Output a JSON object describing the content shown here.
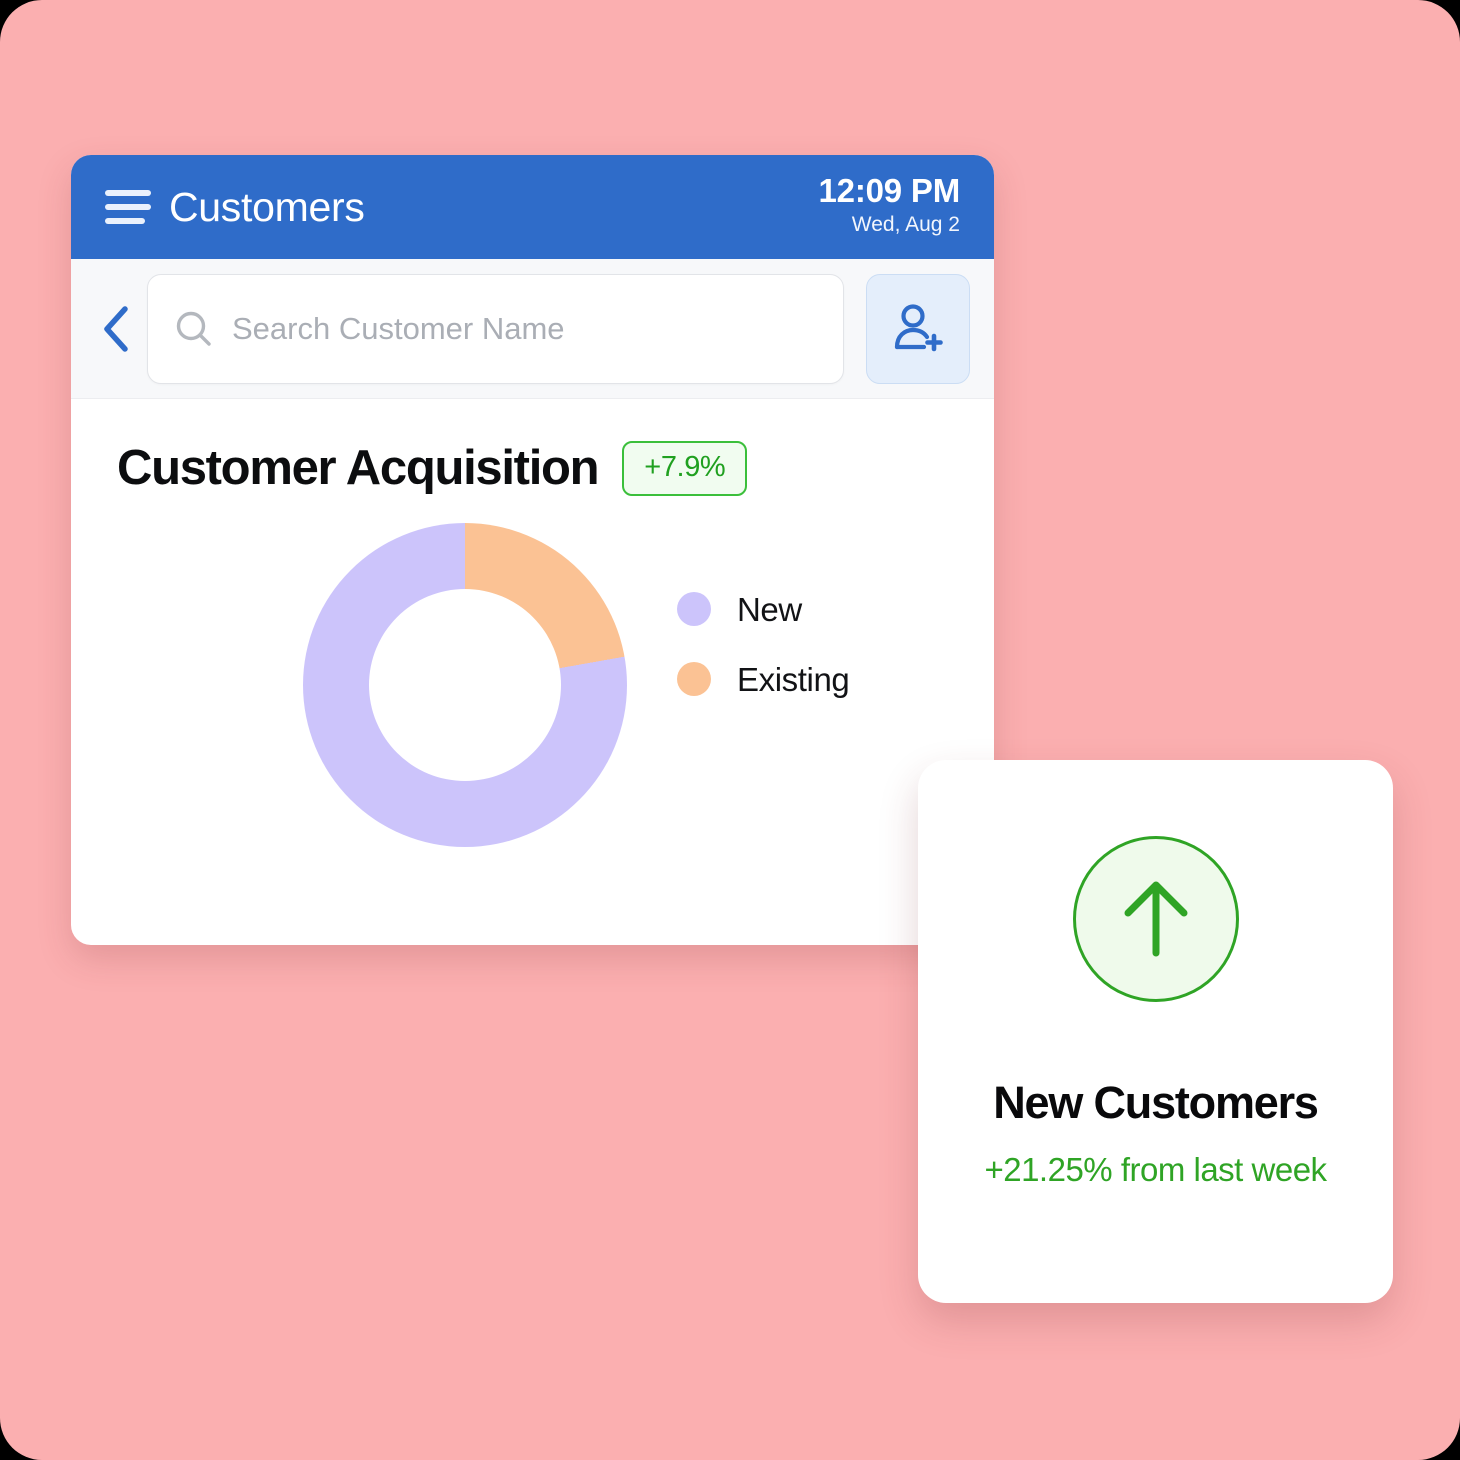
{
  "theme": {
    "page_background": "#FBAFB0",
    "header_blue": "#2F6CC9",
    "accent_green": "#2FA425",
    "series_new_color": "#CCC4FB",
    "series_existing_color": "#FBC294"
  },
  "header": {
    "menu_icon": "hamburger-icon",
    "title": "Customers",
    "time": "12:09 PM",
    "date": "Wed, Aug 2"
  },
  "toolbar": {
    "back_icon": "chevron-left-icon",
    "search_icon": "search-icon",
    "search_value": "",
    "search_placeholder": "Search Customer Name",
    "add_customer_icon": "person-add-icon"
  },
  "section": {
    "title": "Customer Acquisition",
    "delta_badge": "+7.9%"
  },
  "chart_data": {
    "type": "pie",
    "variant": "donut",
    "title": "Customer Acquisition",
    "labels": [
      "New",
      "Existing"
    ],
    "values": [
      77.8,
      22.2
    ],
    "colors": [
      "#CCC4FB",
      "#FBC294"
    ],
    "start_angle_deg": 0,
    "direction": "clockwise",
    "inner_radius_ratio": 0.59,
    "legend_position": "right",
    "grid": false,
    "annotations": [
      "+7.9%"
    ]
  },
  "stat_card": {
    "icon": "arrow-up-circle-icon",
    "title": "New Customers",
    "subtitle": "+21.25% from last week"
  }
}
